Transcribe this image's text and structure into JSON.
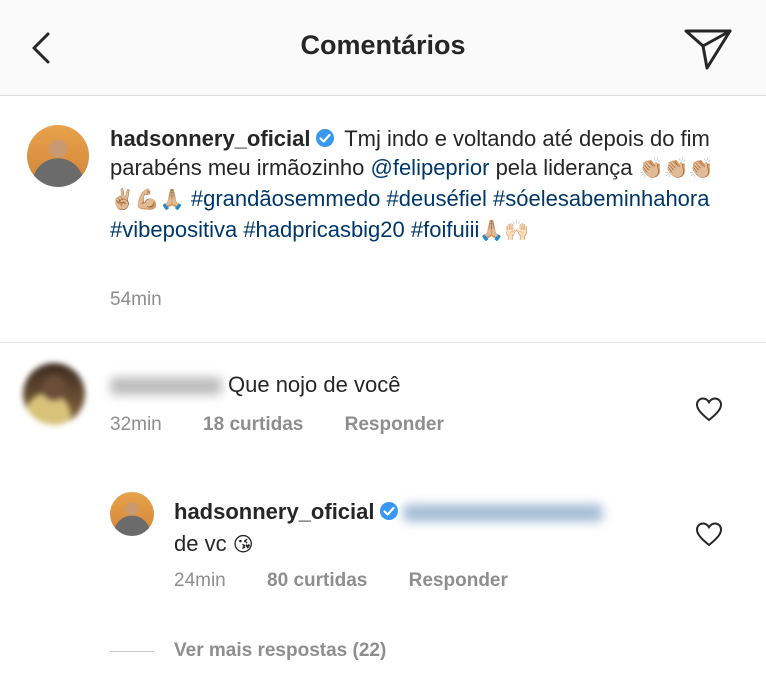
{
  "header": {
    "title": "Comentários"
  },
  "caption": {
    "username": "hadsonnery_oficial",
    "text_1": "Tmj indo e voltando até depois do fim parabéns meu irmãozinho",
    "mention": "@felipeprior",
    "text_2": "pela liderança",
    "emojis_1": "👏🏼👏🏼👏🏼✌🏼💪🏼🙏🏼",
    "hashtags": [
      "#grandãosemmedo",
      "#deuséfiel",
      "#sóelesabeminhahora",
      "#vibepositiva",
      "#hadpricasbig20",
      "#foifuiii"
    ],
    "emojis_2": "🙏🏼🙌🏻",
    "time": "54min"
  },
  "comment": {
    "text": "Que nojo de você",
    "time": "32min",
    "likes": "18 curtidas",
    "reply_label": "Responder"
  },
  "reply": {
    "username": "hadsonnery_oficial",
    "text": "de vc",
    "emoji": "😘",
    "time": "24min",
    "likes": "80 curtidas",
    "reply_label": "Responder"
  },
  "more_replies": "Ver mais respostas (22)"
}
